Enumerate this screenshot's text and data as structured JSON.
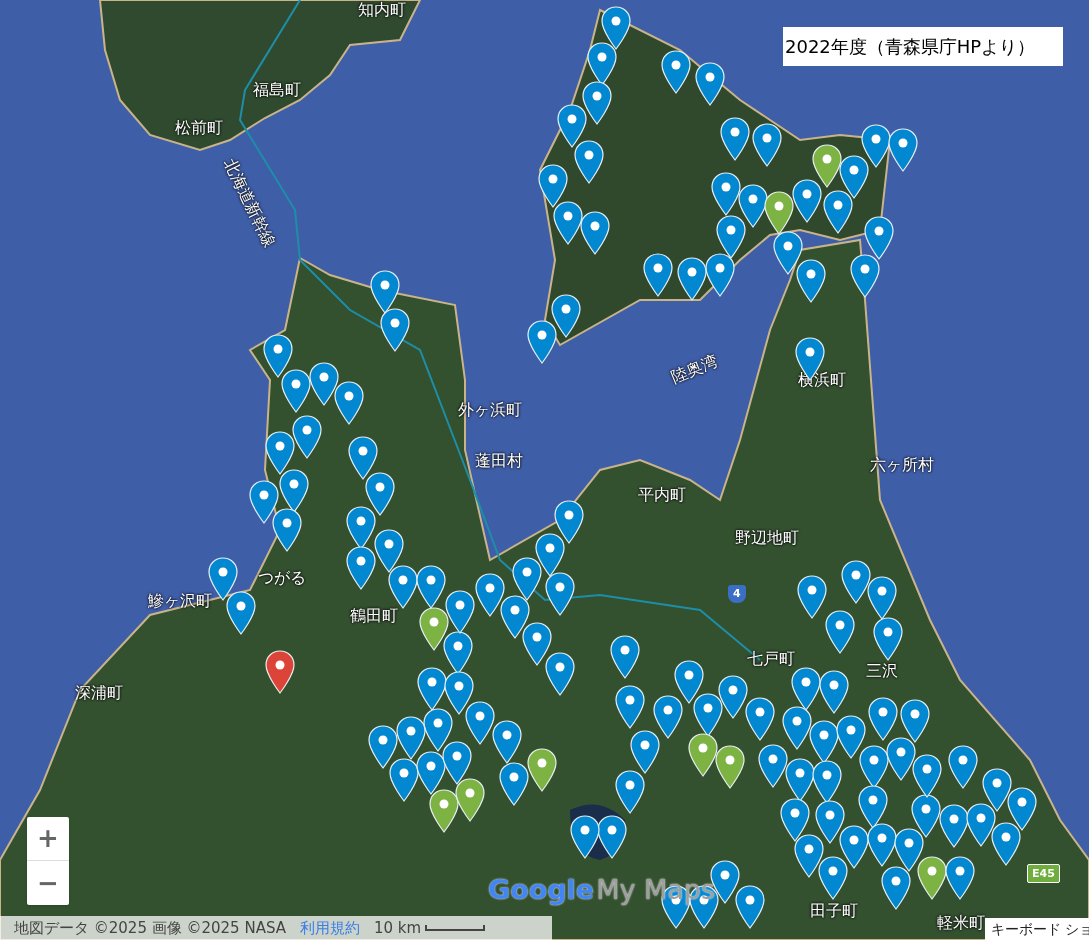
{
  "title_box": "2022年度（青森県庁HPより）",
  "place_labels": [
    {
      "text": "知内町"
    },
    {
      "text": "福島町"
    },
    {
      "text": "松前町"
    },
    {
      "text": "北海道新幹線"
    },
    {
      "text": "外ヶ浜町"
    },
    {
      "text": "蓬田村"
    },
    {
      "text": "平内町"
    },
    {
      "text": "野辺地町"
    },
    {
      "text": "横浜町"
    },
    {
      "text": "六ヶ所村"
    },
    {
      "text": "陸奥湾"
    },
    {
      "text": "つがる"
    },
    {
      "text": "鶴田町"
    },
    {
      "text": "鰺ヶ沢町"
    },
    {
      "text": "深浦町"
    },
    {
      "text": "七戸町"
    },
    {
      "text": "三沢"
    },
    {
      "text": "田子町"
    },
    {
      "text": "軽米町"
    }
  ],
  "road_signs": [
    {
      "text": "4",
      "kind": "route"
    },
    {
      "text": "E45",
      "kind": "expressway"
    }
  ],
  "markers": [
    {
      "color": "#0288d1"
    },
    {
      "color": "#0288d1"
    },
    {
      "color": "#0288d1"
    },
    {
      "color": "#0288d1"
    },
    {
      "color": "#0288d1"
    },
    {
      "color": "#0288d1"
    },
    {
      "color": "#0288d1"
    },
    {
      "color": "#0288d1"
    },
    {
      "color": "#0288d1"
    },
    {
      "color": "#0288d1"
    },
    {
      "color": "#0288d1"
    },
    {
      "color": "#0288d1"
    },
    {
      "color": "#0288d1"
    },
    {
      "color": "#0288d1"
    },
    {
      "color": "#0288d1"
    },
    {
      "color": "#0288d1"
    },
    {
      "color": "#0288d1"
    },
    {
      "color": "#0288d1"
    },
    {
      "color": "#0288d1"
    },
    {
      "color": "#0288d1"
    },
    {
      "color": "#0288d1"
    },
    {
      "color": "#0288d1"
    },
    {
      "color": "#0288d1"
    },
    {
      "color": "#0288d1"
    },
    {
      "color": "#0288d1"
    },
    {
      "color": "#0288d1"
    },
    {
      "color": "#0288d1"
    },
    {
      "color": "#0288d1"
    },
    {
      "color": "#0288d1"
    },
    {
      "color": "#0288d1"
    },
    {
      "color": "#7cb342"
    },
    {
      "color": "#7cb342"
    },
    {
      "color": "#0288d1"
    },
    {
      "color": "#0288d1"
    },
    {
      "color": "#0288d1"
    },
    {
      "color": "#0288d1"
    },
    {
      "color": "#0288d1"
    },
    {
      "color": "#0288d1"
    },
    {
      "color": "#0288d1"
    },
    {
      "color": "#0288d1"
    },
    {
      "color": "#0288d1"
    },
    {
      "color": "#0288d1"
    },
    {
      "color": "#0288d1"
    },
    {
      "color": "#0288d1"
    },
    {
      "color": "#0288d1"
    },
    {
      "color": "#0288d1"
    },
    {
      "color": "#0288d1"
    },
    {
      "color": "#0288d1"
    },
    {
      "color": "#0288d1"
    },
    {
      "color": "#0288d1"
    },
    {
      "color": "#0288d1"
    },
    {
      "color": "#0288d1"
    },
    {
      "color": "#0288d1"
    },
    {
      "color": "#0288d1"
    },
    {
      "color": "#0288d1"
    },
    {
      "color": "#0288d1"
    },
    {
      "color": "#0288d1"
    },
    {
      "color": "#0288d1"
    },
    {
      "color": "#0288d1"
    },
    {
      "color": "#0288d1"
    },
    {
      "color": "#0288d1"
    },
    {
      "color": "#0288d1"
    },
    {
      "color": "#7cb342"
    },
    {
      "color": "#0288d1"
    },
    {
      "color": "#0288d1"
    },
    {
      "color": "#0288d1"
    },
    {
      "color": "#0288d1"
    },
    {
      "color": "#0288d1"
    },
    {
      "color": "#0288d1"
    },
    {
      "color": "#0288d1"
    },
    {
      "color": "#0288d1"
    },
    {
      "color": "#0288d1"
    },
    {
      "color": "#0288d1"
    },
    {
      "color": "#0288d1"
    },
    {
      "color": "#7cb342"
    },
    {
      "color": "#7cb342"
    },
    {
      "color": "#0288d1"
    },
    {
      "color": "#0288d1"
    },
    {
      "color": "#0288d1"
    },
    {
      "color": "#0288d1"
    },
    {
      "color": "#0288d1"
    },
    {
      "color": "#0288d1"
    },
    {
      "color": "#0288d1"
    },
    {
      "color": "#0288d1"
    },
    {
      "color": "#0288d1"
    },
    {
      "color": "#0288d1"
    },
    {
      "color": "#7cb342"
    },
    {
      "color": "#7cb342"
    },
    {
      "color": "#7cb342"
    },
    {
      "color": "#7cb342"
    },
    {
      "color": "#0288d1"
    },
    {
      "color": "#0288d1"
    },
    {
      "color": "#0288d1"
    },
    {
      "color": "#0288d1"
    },
    {
      "color": "#0288d1"
    },
    {
      "color": "#0288d1"
    },
    {
      "color": "#0288d1"
    },
    {
      "color": "#0288d1"
    },
    {
      "color": "#0288d1"
    },
    {
      "color": "#0288d1"
    },
    {
      "color": "#0288d1"
    },
    {
      "color": "#0288d1"
    },
    {
      "color": "#0288d1"
    },
    {
      "color": "#0288d1"
    },
    {
      "color": "#0288d1"
    },
    {
      "color": "#0288d1"
    },
    {
      "color": "#0288d1"
    },
    {
      "color": "#0288d1"
    },
    {
      "color": "#0288d1"
    },
    {
      "color": "#0288d1"
    },
    {
      "color": "#0288d1"
    },
    {
      "color": "#0288d1"
    },
    {
      "color": "#0288d1"
    },
    {
      "color": "#0288d1"
    },
    {
      "color": "#0288d1"
    },
    {
      "color": "#0288d1"
    },
    {
      "color": "#0288d1"
    },
    {
      "color": "#0288d1"
    },
    {
      "color": "#0288d1"
    },
    {
      "color": "#0288d1"
    },
    {
      "color": "#0288d1"
    },
    {
      "color": "#0288d1"
    },
    {
      "color": "#0288d1"
    },
    {
      "color": "#0288d1"
    },
    {
      "color": "#0288d1"
    },
    {
      "color": "#0288d1"
    },
    {
      "color": "#0288d1"
    },
    {
      "color": "#0288d1"
    },
    {
      "color": "#0288d1"
    },
    {
      "color": "#0288d1"
    },
    {
      "color": "#db4437"
    }
  ],
  "zoom_controls": [
    "+",
    "−"
  ],
  "logo": {
    "brand": "Google",
    "product": "My Maps"
  },
  "attribution": {
    "text": "地図データ ©2025 画像 ©2025 NASA",
    "terms_link": "利用規約",
    "scale": "10 km"
  },
  "keyboard_shortcuts": "キーボード ショ"
}
